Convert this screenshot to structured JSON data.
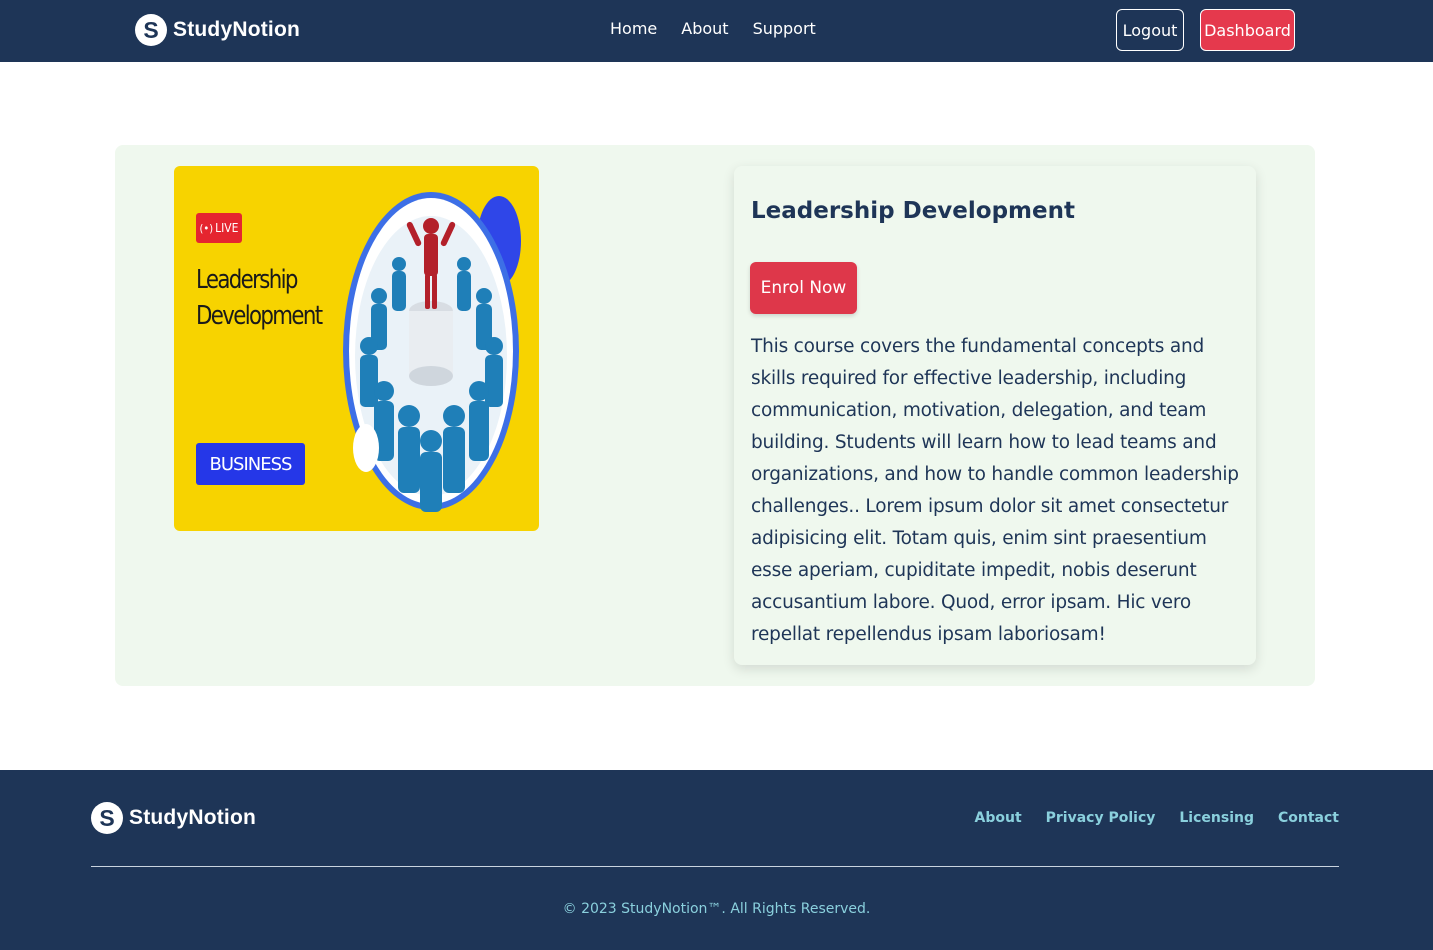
{
  "nav": {
    "brand": "StudyNotion",
    "logo_letter": "S",
    "links": [
      "Home",
      "About",
      "Support"
    ],
    "logout_label": "Logout",
    "dashboard_label": "Dashboard"
  },
  "course": {
    "thumbnail": {
      "live_label": "LIVE",
      "title_line1": "Leadership",
      "title_line2": "Development",
      "category_label": "BUSINESS"
    },
    "title": "Leadership Development",
    "enrol_label": "Enrol Now",
    "description": "This course covers the fundamental concepts and skills required for effective leadership, including communication, motivation, delegation, and team building. Students will learn how to lead teams and organizations, and how to handle common leadership challenges.. Lorem ipsum dolor sit amet consectetur adipisicing elit. Totam quis, enim sint praesentium esse aperiam, cupiditate impedit, nobis deserunt accusantium labore. Quod, error ipsam. Hic vero repellat repellendus ipsam laboriosam!"
  },
  "footer": {
    "brand": "StudyNotion",
    "logo_letter": "S",
    "links": [
      "About",
      "Privacy Policy",
      "Licensing",
      "Contact"
    ],
    "copyright": "© 2023 StudyNotion™. All Rights Reserved."
  },
  "colors": {
    "navy": "#1e3557",
    "accent_red": "#e5394d",
    "panel_bg": "#eff8ee",
    "thumbnail_yellow": "#f7d300",
    "footer_link": "#8ad0dd"
  },
  "icons": [
    "studynotion-logo-icon",
    "live-broadcast-icon",
    "leader-crowd-illustration"
  ]
}
